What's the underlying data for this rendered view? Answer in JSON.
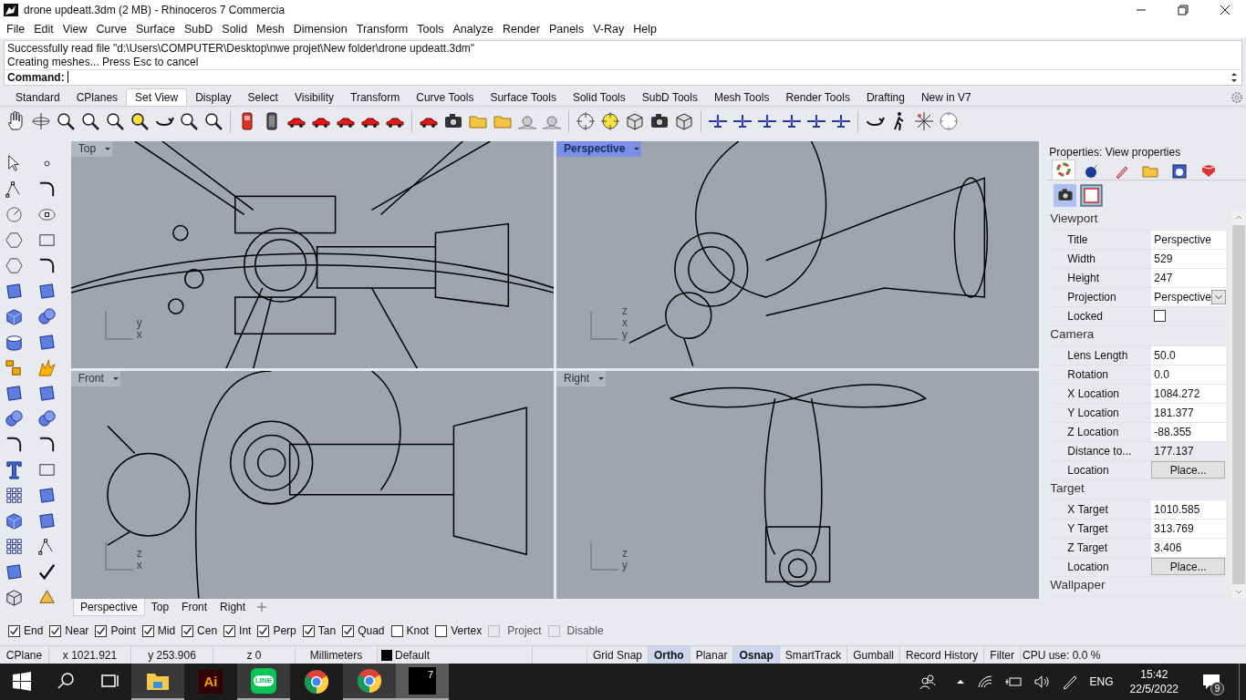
{
  "window": {
    "title": "drone updeatt.3dm (2 MB) - Rhinoceros 7 Commercia"
  },
  "menu": [
    "File",
    "Edit",
    "View",
    "Curve",
    "Surface",
    "SubD",
    "Solid",
    "Mesh",
    "Dimension",
    "Transform",
    "Tools",
    "Analyze",
    "Render",
    "Panels",
    "V-Ray",
    "Help"
  ],
  "command": {
    "history": [
      "Successfully read file \"d:\\Users\\COMPUTER\\Desktop\\nwe projet\\New folder\\drone updeatt.3dm\"",
      "Creating meshes... Press Esc to cancel"
    ],
    "prompt": "Command:"
  },
  "toolbar_tabs": [
    {
      "label": "Standard",
      "selected": false
    },
    {
      "label": "CPlanes",
      "selected": false
    },
    {
      "label": "Set View",
      "selected": true
    },
    {
      "label": "Display",
      "selected": false
    },
    {
      "label": "Select",
      "selected": false
    },
    {
      "label": "Visibility",
      "selected": false
    },
    {
      "label": "Transform",
      "selected": false
    },
    {
      "label": "Curve Tools",
      "selected": false
    },
    {
      "label": "Surface Tools",
      "selected": false
    },
    {
      "label": "Solid Tools",
      "selected": false
    },
    {
      "label": "SubD Tools",
      "selected": false
    },
    {
      "label": "Mesh Tools",
      "selected": false
    },
    {
      "label": "Render Tools",
      "selected": false
    },
    {
      "label": "Drafting",
      "selected": false
    },
    {
      "label": "New in V7",
      "selected": false
    }
  ],
  "viewports": [
    {
      "title": "Top",
      "selected": false,
      "axes": [
        "y",
        "x"
      ]
    },
    {
      "title": "Perspective",
      "selected": true,
      "axes": [
        "z",
        "x",
        "y"
      ]
    },
    {
      "title": "Front",
      "selected": false,
      "axes": [
        "z",
        "x"
      ]
    },
    {
      "title": "Right",
      "selected": false,
      "axes": [
        "z",
        "y"
      ]
    }
  ],
  "viewport_tabs": [
    {
      "label": "Perspective",
      "selected": true
    },
    {
      "label": "Top",
      "selected": false
    },
    {
      "label": "Front",
      "selected": false
    },
    {
      "label": "Right",
      "selected": false
    }
  ],
  "properties": {
    "title": "Properties: View properties",
    "sections": [
      {
        "title": "Viewport",
        "rows": [
          {
            "label": "Title",
            "kind": "text",
            "value": "Perspective"
          },
          {
            "label": "Width",
            "kind": "text",
            "value": "529"
          },
          {
            "label": "Height",
            "kind": "text",
            "value": "247"
          },
          {
            "label": "Projection",
            "kind": "dropdown",
            "value": "Perspective"
          },
          {
            "label": "Locked",
            "kind": "checkbox",
            "checked": false
          }
        ]
      },
      {
        "title": "Camera",
        "rows": [
          {
            "label": "Lens Length",
            "kind": "text",
            "value": "50.0"
          },
          {
            "label": "Rotation",
            "kind": "text",
            "value": "0.0"
          },
          {
            "label": "X Location",
            "kind": "text",
            "value": "1084.272"
          },
          {
            "label": "Y Location",
            "kind": "text",
            "value": "181.377"
          },
          {
            "label": "Z Location",
            "kind": "text",
            "value": "-88.355"
          },
          {
            "label": "Distance to...",
            "kind": "readonly",
            "value": "177.137"
          },
          {
            "label": "Location",
            "kind": "button",
            "value": "Place..."
          }
        ]
      },
      {
        "title": "Target",
        "rows": [
          {
            "label": "X Target",
            "kind": "text",
            "value": "1010.585"
          },
          {
            "label": "Y Target",
            "kind": "text",
            "value": "313.769"
          },
          {
            "label": "Z Target",
            "kind": "text",
            "value": "3.406"
          },
          {
            "label": "Location",
            "kind": "button",
            "value": "Place..."
          }
        ]
      },
      {
        "title": "Wallpaper"
      }
    ]
  },
  "osnaps": [
    {
      "label": "End",
      "checked": true,
      "disabled": false
    },
    {
      "label": "Near",
      "checked": true,
      "disabled": false
    },
    {
      "label": "Point",
      "checked": true,
      "disabled": false
    },
    {
      "label": "Mid",
      "checked": true,
      "disabled": false
    },
    {
      "label": "Cen",
      "checked": true,
      "disabled": false
    },
    {
      "label": "Int",
      "checked": true,
      "disabled": false
    },
    {
      "label": "Perp",
      "checked": true,
      "disabled": false
    },
    {
      "label": "Tan",
      "checked": true,
      "disabled": false
    },
    {
      "label": "Quad",
      "checked": true,
      "disabled": false
    },
    {
      "label": "Knot",
      "checked": false,
      "disabled": false
    },
    {
      "label": "Vertex",
      "checked": false,
      "disabled": false
    },
    {
      "label": "Project",
      "checked": false,
      "disabled": true
    },
    {
      "label": "Disable",
      "checked": false,
      "disabled": true
    }
  ],
  "status_bar": {
    "cells": [
      {
        "kind": "plain",
        "text": "CPlane"
      },
      {
        "kind": "plain",
        "text": "x 1021.921"
      },
      {
        "kind": "plain",
        "text": "y 253.906"
      },
      {
        "kind": "plain",
        "text": "z 0"
      },
      {
        "kind": "plain",
        "text": "Millimeters"
      },
      {
        "kind": "layer",
        "text": "Default",
        "color": "#000000"
      }
    ],
    "toggles": [
      {
        "text": "Grid Snap",
        "on": false
      },
      {
        "text": "Ortho",
        "on": true
      },
      {
        "text": "Planar",
        "on": false
      },
      {
        "text": "Osnap",
        "on": true
      },
      {
        "text": "SmartTrack",
        "on": false
      },
      {
        "text": "Gumball",
        "on": false
      },
      {
        "text": "Record History",
        "on": false
      },
      {
        "text": "Filter",
        "on": false
      }
    ],
    "cpu": "CPU use: 0.0 %"
  },
  "taskbar": {
    "apps": [
      {
        "kind": "folder",
        "open": true,
        "selected": false
      },
      {
        "kind": "ai",
        "label": "Ai",
        "open": false,
        "selected": false
      },
      {
        "kind": "line",
        "label": "LINE",
        "open": true,
        "selected": false
      },
      {
        "kind": "chrome",
        "open": false,
        "selected": false
      },
      {
        "kind": "chrome",
        "open": true,
        "selected": false
      },
      {
        "kind": "rhino",
        "label": "7",
        "open": true,
        "selected": true
      }
    ],
    "language": "ENG",
    "time": "15:42",
    "date": "22/5/2022",
    "notifications": "9"
  }
}
